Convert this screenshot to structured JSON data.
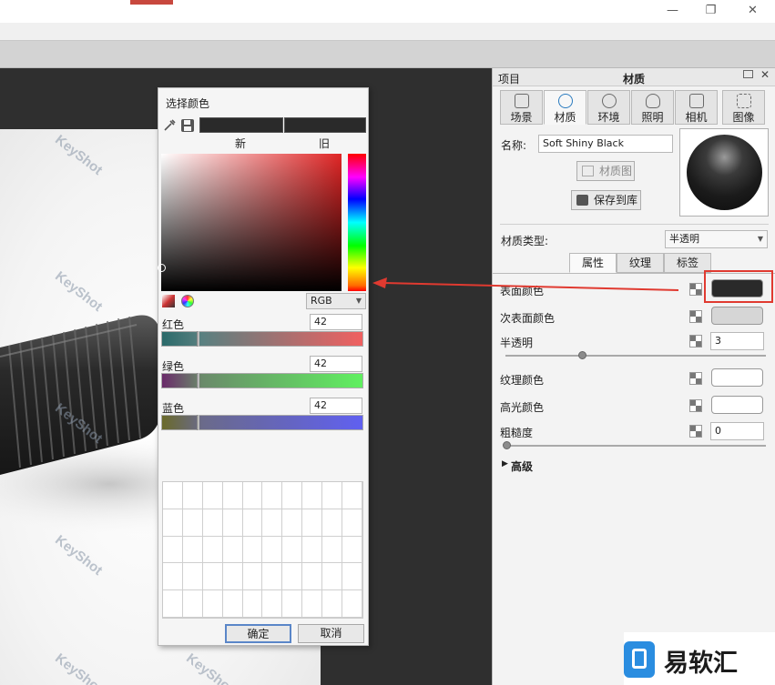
{
  "window": {
    "minimize_glyph": "—",
    "restore_glyph": "❐",
    "close_glyph": "✕"
  },
  "viewport": {
    "watermark_text": "KeyShot"
  },
  "color_dialog": {
    "title": "选择颜色",
    "new_label": "新",
    "old_label": "旧",
    "mode_value": "RGB",
    "channels": [
      {
        "label": "红色",
        "value": "42"
      },
      {
        "label": "绿色",
        "value": "42"
      },
      {
        "label": "蓝色",
        "value": "42"
      }
    ],
    "ok_label": "确定",
    "cancel_label": "取消"
  },
  "panel": {
    "left_title": "项目",
    "center_title": "材质",
    "tabs": [
      {
        "label": "场景",
        "icon": "list-icon"
      },
      {
        "label": "材质",
        "icon": "material-icon"
      },
      {
        "label": "环境",
        "icon": "globe-icon"
      },
      {
        "label": "照明",
        "icon": "bulb-icon"
      },
      {
        "label": "相机",
        "icon": "camera-icon"
      },
      {
        "label": "图像",
        "icon": "image-icon"
      }
    ],
    "name_label": "名称:",
    "name_value": "Soft Shiny Black",
    "material_graph_label": "材质图",
    "save_to_library_label": "保存到库",
    "material_type_label": "材质类型:",
    "material_type_value": "半透明",
    "subtabs": [
      "属性",
      "纹理",
      "标签"
    ],
    "properties": [
      {
        "label": "表面颜色",
        "type": "color",
        "color": "#2a2a2a"
      },
      {
        "label": "次表面颜色",
        "type": "color",
        "color": "#d6d6d6"
      },
      {
        "label": "半透明",
        "type": "number",
        "value": "3"
      },
      {
        "label": "纹理颜色",
        "type": "color",
        "color": "#ffffff"
      },
      {
        "label": "高光颜色",
        "type": "color",
        "color": "#ffffff"
      },
      {
        "label": "粗糙度",
        "type": "number",
        "value": "0"
      }
    ],
    "advanced_label": "高级"
  },
  "logo": {
    "text": "易软汇"
  },
  "colors": {
    "highlight_red": "#e03a30",
    "surface_color": "#2a2a2a"
  }
}
